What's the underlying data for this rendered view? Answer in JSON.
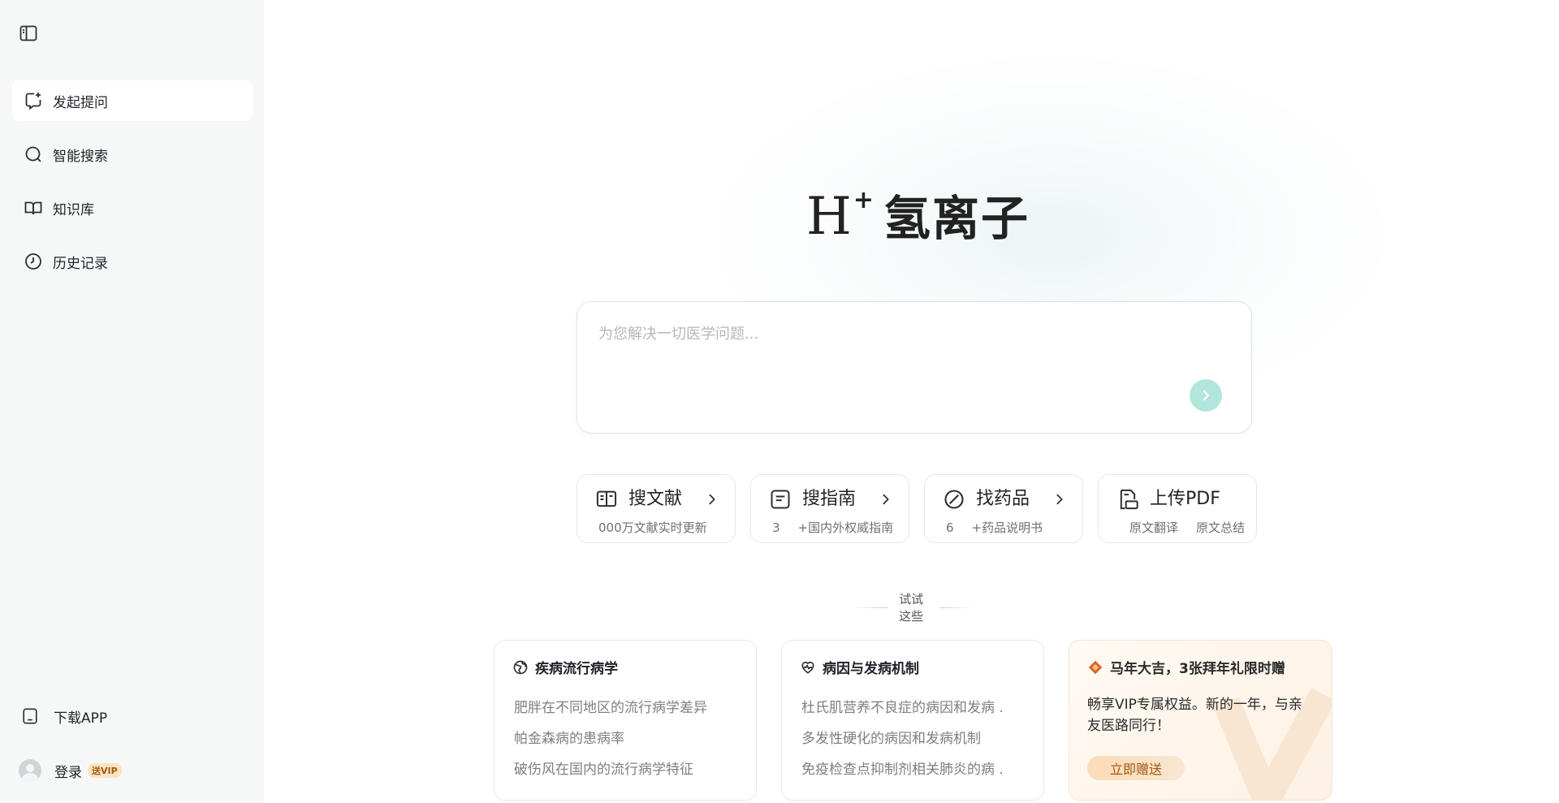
{
  "sidebar": {
    "toggle_icon": "sidebar-toggle-icon",
    "items": [
      {
        "label": "发起提问",
        "icon": "new-chat-icon",
        "active": true
      },
      {
        "label": "智能搜索",
        "icon": "search-icon",
        "active": false
      },
      {
        "label": "知识库",
        "icon": "book-open-icon",
        "active": false
      },
      {
        "label": "历史记录",
        "icon": "clock-icon",
        "active": false
      }
    ],
    "download_app": "下载APP",
    "login": "登录",
    "vip_badge": "送VIP"
  },
  "brand": {
    "h": "H",
    "plus": "+",
    "name": "氢离子"
  },
  "ask": {
    "placeholder": "为您解决一切医学问题..."
  },
  "quick_actions": [
    {
      "title": "搜文献",
      "sub_a": "000万文献实时更新",
      "sub_b": "",
      "icon": "literature-icon"
    },
    {
      "title": "搜指南",
      "sub_a": "3",
      "sub_b": "+国内外权威指南",
      "icon": "guide-icon"
    },
    {
      "title": "找药品",
      "sub_a": "6",
      "sub_b": "+药品说明书",
      "icon": "pill-icon"
    },
    {
      "title": "上传PDF",
      "sub_a": "原文翻译",
      "sub_b": "原文总结",
      "icon": "pdf-icon"
    }
  ],
  "try_label": "试试这些",
  "topics": [
    {
      "title": "疾病流行病学",
      "icon": "globe-icon",
      "items": [
        "肥胖在不同地区的流行病学差异",
        "帕金森病的患病率",
        "破伤风在国内的流行病学特征"
      ]
    },
    {
      "title": "病因与发病机制",
      "icon": "heart-pulse-icon",
      "items": [
        "杜氏肌营养不良症的病因和发病  .",
        "多发性硬化的病因和发病机制",
        "免疫检查点抑制剂相关肺炎的病  ."
      ]
    }
  ],
  "promo": {
    "title": "马年大吉，3张拜年礼限时赠",
    "text": "畅享VIP专属权益。新的一年，与亲友医路同行！",
    "button": "立即赠送",
    "icon": "fortune-icon"
  },
  "colors": {
    "accent": "#b2e6dc",
    "sidebar_bg": "#f6f8f8",
    "promo_button_text": "#a4540f"
  }
}
